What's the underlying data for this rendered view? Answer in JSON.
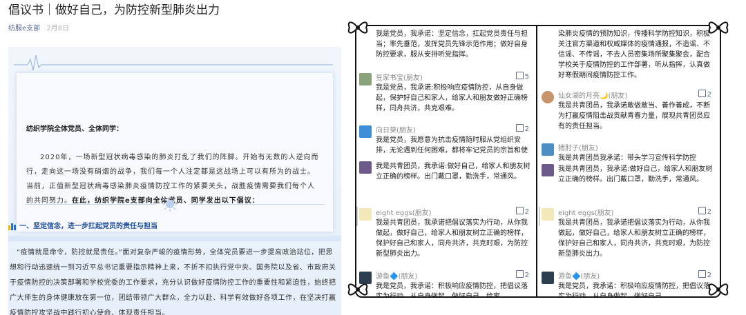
{
  "article": {
    "title": "倡议书｜做好自己，为防控新型肺炎出力",
    "author": "纺服e支部",
    "date": "2月8日",
    "greeting": "纺织学院全体党员、全体同学：",
    "paragraph": "2020年，一场新型冠状病毒感染的肺炎打乱了我们的阵脚。开始有无数的人逆向而行，走向这一场没有硝烟的战争，我们每一个人注定都是这战场上可以有所为的战士。当前，正值新型冠状病毒感染肺炎疫情防控工作的紧要关头，战胜疫情需要我们每个人的共同努力。",
    "paragraph_bold": "在此，纺织学院e支部向全体党员、同学发出以下倡议：",
    "section_heading": "一、坚定信念，进一步扛起党员的责任与担当",
    "body": "“疫情就是命令，防控就是责任。”面对复杂严峻的疫情形势，全体党员要进一步提高政治站位，把思想和行动迅速统一到习近平总书记重要指示精神上来，不折不扣执行党中央、国务院以及省、市政府关于疫情防控的决策部署和学校党委的工作要求，充分认识做好疫情防控工作的重要性和紧迫性，始终把广大师生的身体健康放在第一位，团结带领广大群众，全力以赴、科学有效做好各项工作，在坚决打赢疫情防控攻坚战中践行初心使命、体现责任担当。"
  },
  "comments_left": [
    {
      "name": "",
      "likes": "",
      "text": "我是党员，我承诺：坚定信念，扛起党员责任与担当；率先垂范，发挥党员先锋示范作用；做好自身防控要求，服从安排听党指挥。"
    },
    {
      "name": "豆家书宝(朋友)",
      "likes": "5",
      "text": "我是党员，我承诺:积极响应疫情防控，从自身做起，保护好自己和家人，给家人和朋友做好正确榜样，同舟共济，共克艰难。"
    },
    {
      "name": "向日葵(朋友)",
      "likes": "2",
      "text": "我是党员，我愿意为抗击疫情随时服从党组织安排，无论遇到任何困难，都将牢记党员的宗旨和使命，忠诚履职尽责，积极配合抗击"
    },
    {
      "name": "",
      "likes": "",
      "text": "我是共青团员，我承诺:做好自己，给家人和朋友树立正确的榜样。出门戴口罩，勤洗手，常通风。"
    },
    {
      "name": "eight eggs(朋友)",
      "likes": "2",
      "text": "我是共青团员，我承诺把倡议落实为行动，从你我做起，做好自己，给家人和朋友树立正确的榜样，保护好自己和家人，同舟共济，共克时艰，为防控新型肺炎出力。"
    },
    {
      "name": "游鱼🔷(朋友)",
      "likes": "2",
      "text": "我是党员，我承诺：积极响应疫情防控，把倡议落实为行动，从自身做起，做好自己，给家"
    }
  ],
  "comments_right": [
    {
      "name": "",
      "likes": "",
      "text": "染肺炎疫情的预防知识，传播科学防控知识，积极关注官方渠道和权威媒体的疫情通报，不造谣、不信谣、不传谣，不去人员密集场所聚集聚会，配合学校关于疫情防控的工作部署，听从指挥，认真做好寒假期间疫情防控工作。"
    },
    {
      "name": "仙女湖的月亮🌙(朋友)",
      "likes": "2",
      "text": "我是共青团员，我承诺敢做敢当、善作善成，不断为打赢疫情阻击战贡献青春力量，展现共青团员应有的责任担当。"
    },
    {
      "name": "猪肘子(朋友)",
      "likes": "",
      "text": "我是共青团员我承诺：带头学习宣传科学防控"
    },
    {
      "name": "",
      "likes": "",
      "text": "我是共青团员，我承诺:做好自己，给家人和朋友树立正确的榜样。出门戴口罩，勤洗手，常通风。"
    },
    {
      "name": "eight eggs(朋友)",
      "likes": "2",
      "text": "我是共青团员，我承诺把倡议落实为行动，从你我做起，做好自己，给家人和朋友树立正确的榜样，保护好自己和家人，同舟共济，共克时艰，为防控新型肺炎出力。"
    },
    {
      "name": "游鱼🔷(朋友)",
      "likes": "2",
      "text": "我是党员，我承诺：积极响应疫情防控，把倡议落实为行动，从自身做起，做好自己"
    }
  ],
  "colors": {
    "link": "#576b95",
    "heading_blue": "#1f4e9a",
    "accent_orange": "#f0b21b",
    "frame": "#111111"
  }
}
